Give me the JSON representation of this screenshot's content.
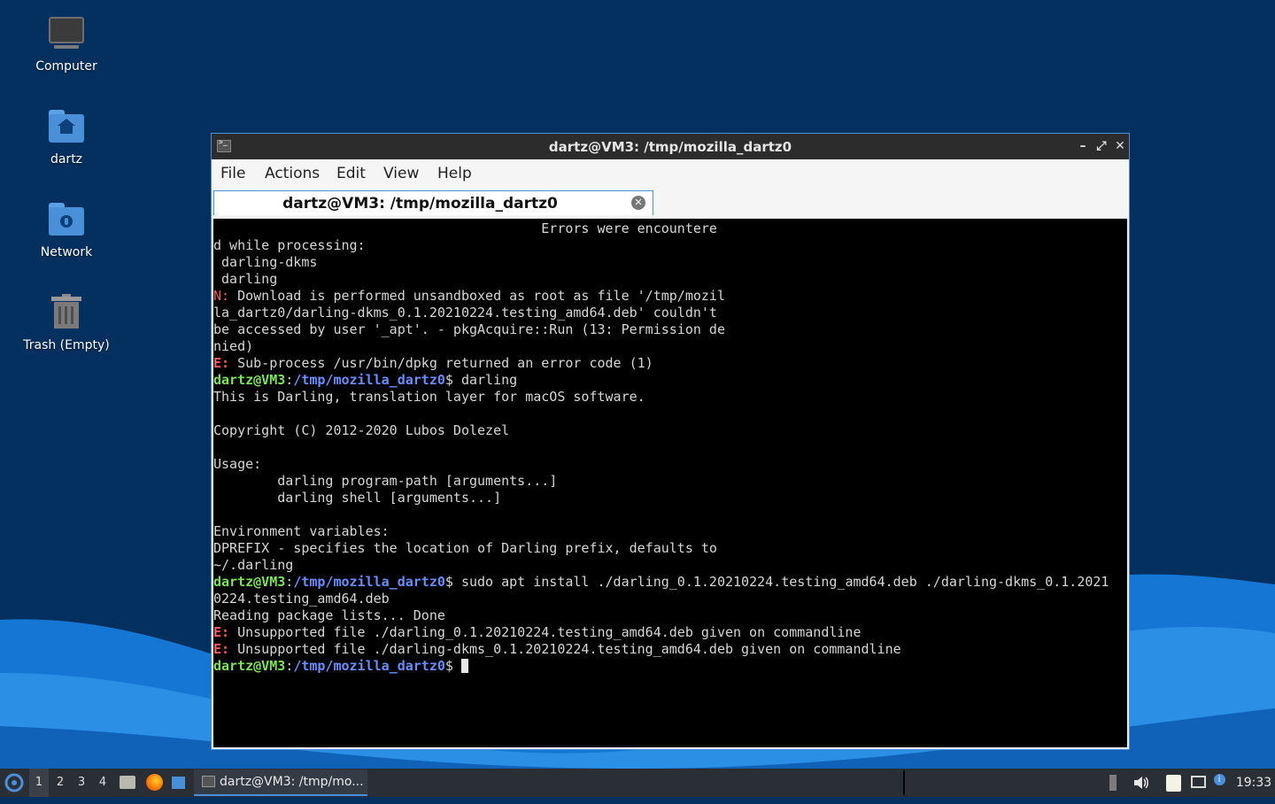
{
  "desktop": {
    "icons": [
      {
        "label": "Computer"
      },
      {
        "label": "dartz"
      },
      {
        "label": "Network"
      },
      {
        "label": "Trash (Empty)"
      }
    ]
  },
  "window": {
    "title": "dartz@VM3: /tmp/mozilla_dartz0",
    "buttons": {
      "minimize": "–",
      "maximize": "⤢",
      "close": "✕"
    },
    "menu": [
      "File",
      "Actions",
      "Edit",
      "View",
      "Help"
    ],
    "tab": {
      "title": "dartz@VM3: /tmp/mozilla_dartz0",
      "close": "✕"
    }
  },
  "terminal": {
    "lines": [
      {
        "text": "                                         Errors were encountere"
      },
      {
        "text": "d while processing:"
      },
      {
        "text": " darling-dkms"
      },
      {
        "text": " darling"
      },
      {
        "label": "N:",
        "label_class": "lbl-N",
        "text": " Download is performed unsandboxed as root as file '/tmp/mozil"
      },
      {
        "text": "la_dartz0/darling-dkms_0.1.20210224.testing_amd64.deb' couldn't"
      },
      {
        "text": "be accessed by user '_apt'. - pkgAcquire::Run (13: Permission de"
      },
      {
        "text": "nied)"
      },
      {
        "label": "E:",
        "label_class": "lbl-E",
        "text": " Sub-process /usr/bin/dpkg returned an error code (1)"
      },
      {
        "prompt": true,
        "text": " darling"
      },
      {
        "text": "This is Darling, translation layer for macOS software."
      },
      {
        "text": ""
      },
      {
        "text": "Copyright (C) 2012-2020 Lubos Dolezel"
      },
      {
        "text": ""
      },
      {
        "text": "Usage:"
      },
      {
        "text": "        darling program-path [arguments...]"
      },
      {
        "text": "        darling shell [arguments...]"
      },
      {
        "text": ""
      },
      {
        "text": "Environment variables:"
      },
      {
        "text": "DPREFIX - specifies the location of Darling prefix, defaults to"
      },
      {
        "text": "~/.darling"
      },
      {
        "prompt": true,
        "text": " sudo apt install ./darling_0.1.20210224.testing_amd64.deb ./darling-dkms_0.1.2021"
      },
      {
        "text": "0224.testing_amd64.deb"
      },
      {
        "text": "Reading package lists... Done"
      },
      {
        "label": "E:",
        "label_class": "lbl-E",
        "text": " Unsupported file ./darling_0.1.20210224.testing_amd64.deb given on commandline"
      },
      {
        "label": "E:",
        "label_class": "lbl-E",
        "text": " Unsupported file ./darling-dkms_0.1.20210224.testing_amd64.deb given on commandline"
      },
      {
        "prompt": true,
        "text": " ",
        "cursor": true
      }
    ],
    "prompt": {
      "user": "dartz@VM3",
      "sep": ":",
      "path": "/tmp/mozilla_dartz0",
      "sym": "$"
    }
  },
  "taskbar": {
    "workspaces": [
      "1",
      "2",
      "3",
      "4"
    ],
    "active_workspace": "1",
    "task_label": "dartz@VM3: /tmp/mo...",
    "clock": "19:33"
  },
  "colors": {
    "desktop_bg": "#03305e",
    "accent": "#4a90d9",
    "prompt_user": "#7ee25a",
    "prompt_path": "#6d8dff",
    "error": "#ff5c5c"
  }
}
